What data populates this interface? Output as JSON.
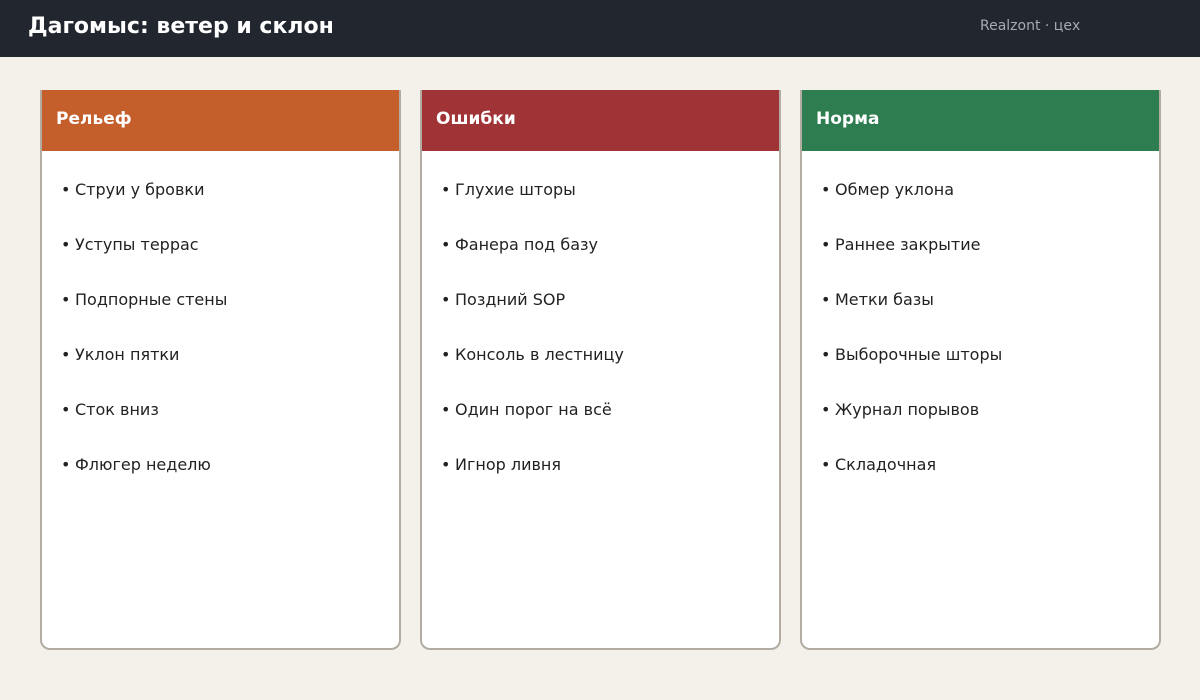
{
  "header": {
    "title": "Дагомыс: ветер и склон",
    "brand": "Realzont · цех"
  },
  "colors": {
    "header_bg": "#22262e",
    "page_bg": "#f4f1ea",
    "relief": "#c45e2b",
    "errors": "#a03335",
    "norm": "#2e7d51"
  },
  "columns": [
    {
      "title": "Рельеф",
      "color": "#c45e2b",
      "items": [
        "Струи у бровки",
        "Уступы террас",
        "Подпорные стены",
        "Уклон пятки",
        "Сток вниз",
        "Флюгер неделю"
      ]
    },
    {
      "title": "Ошибки",
      "color": "#a03335",
      "items": [
        "Глухие шторы",
        "Фанера под базу",
        "Поздний SOP",
        "Консоль в лестницу",
        "Один порог на всё",
        "Игнор ливня"
      ]
    },
    {
      "title": "Норма",
      "color": "#2e7d51",
      "items": [
        "Обмер уклона",
        "Раннее закрытие",
        "Метки базы",
        "Выборочные шторы",
        "Журнал порывов",
        "Складочная"
      ]
    }
  ]
}
